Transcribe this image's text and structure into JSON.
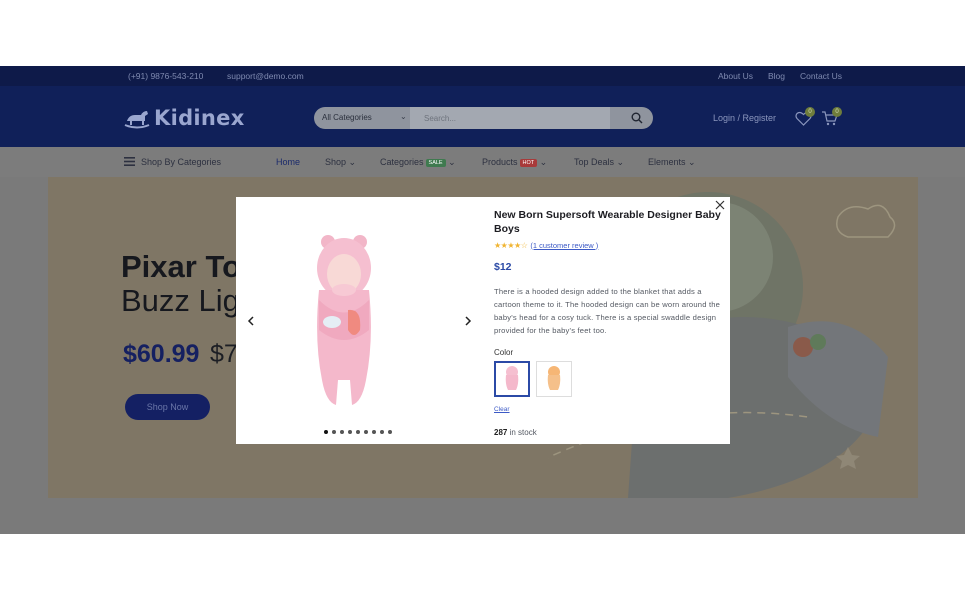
{
  "topbar": {
    "phone": "(+91) 9876-543-210",
    "email": "support@demo.com",
    "links": [
      "About Us",
      "Blog",
      "Contact Us"
    ]
  },
  "header": {
    "logo_text": "Kidinex",
    "category_select": "All Categories",
    "search_placeholder": "Search...",
    "login_label": "Login / Register",
    "wishlist_count": "0",
    "cart_count": "0"
  },
  "nav": {
    "shop_by_categories": "Shop By Categories",
    "items": [
      {
        "label": "Home"
      },
      {
        "label": "Shop"
      },
      {
        "label": "Categories",
        "badge": "SALE"
      },
      {
        "label": "Products",
        "badge": "HOT"
      },
      {
        "label": "Top Deals"
      },
      {
        "label": "Elements"
      }
    ]
  },
  "banner": {
    "title_line1": "Pixar Toy",
    "title_line2": "Buzz Lig",
    "price": "$60.99",
    "old_price": "$7",
    "button": "Shop Now"
  },
  "quickview": {
    "title": "New Born Supersoft Wearable Designer Baby Boys",
    "rating": 4,
    "rating_max": 5,
    "review_link": "(1 customer review )",
    "price": "$12",
    "description": "There is a hooded design added to the blanket that adds a cartoon theme to it. The hooded design can be worn around the baby's head for a cosy tuck. There is a special swaddle design provided for the baby's feet too.",
    "color_label": "Color",
    "clear_label": "Clear",
    "stock_count": "287",
    "stock_suffix": " in stock",
    "slide_count": 9,
    "active_slide": 1
  },
  "colors": {
    "header_bg": "#102059",
    "accent": "#2b4aa6",
    "star": "#f0b431",
    "sale_badge": "#3f7a4f",
    "hot_badge": "#a83a3a"
  }
}
